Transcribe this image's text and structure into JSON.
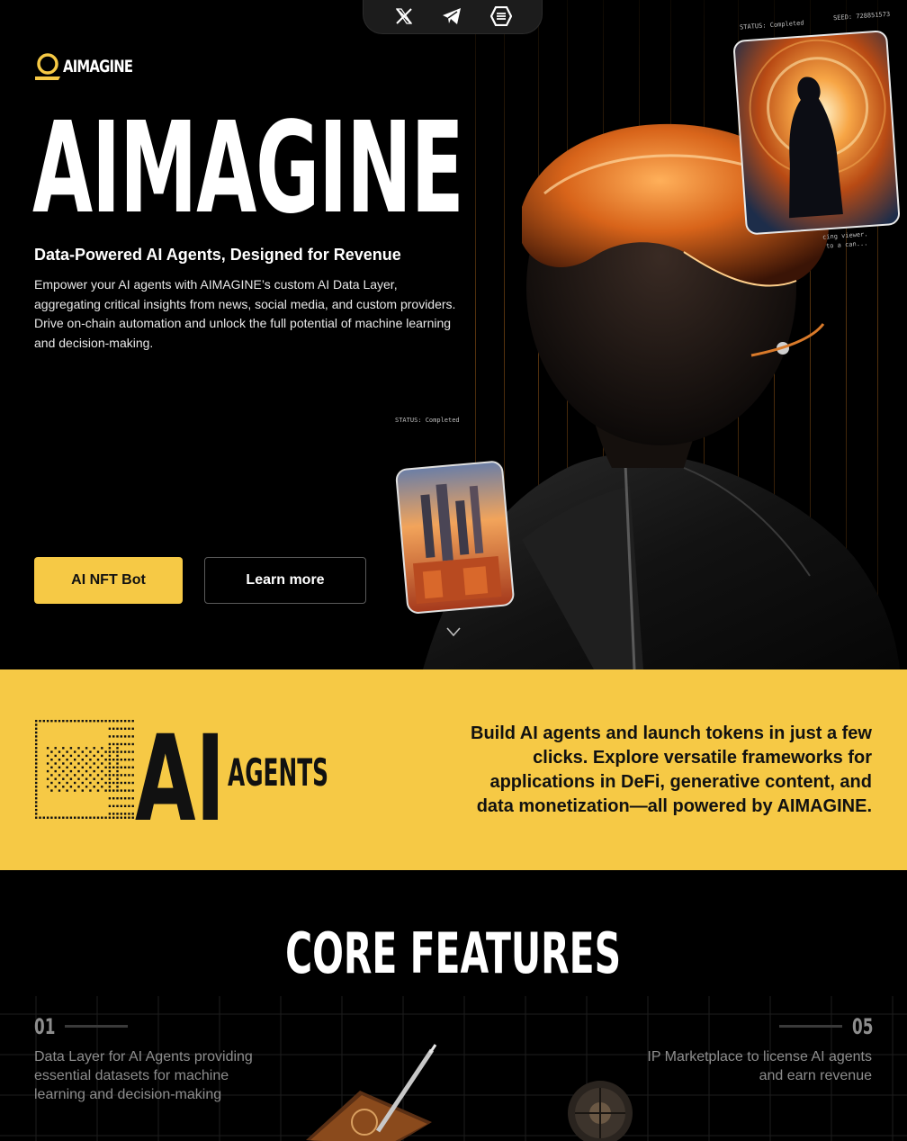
{
  "social": {
    "icons": [
      "x-icon",
      "telegram-icon",
      "token-icon"
    ]
  },
  "logo": {
    "text": "AIMAGINE"
  },
  "hero": {
    "title": "AIMAGINE",
    "subtitle": "Data-Powered AI Agents, Designed for Revenue",
    "description": "Empower your AI agents with AIMAGINE’s custom AI Data Layer, aggregating critical insights from news, social media, and custom providers. Drive on-chain automation and unlock the full potential of machine learning and decision-making.",
    "primary_button": "AI NFT Bot",
    "secondary_button": "Learn more",
    "card_top": {
      "status": "STATUS: Completed",
      "seed": "SEED: 728851573",
      "caption_1": "cing viewer.",
      "caption_2": "to a can..."
    },
    "card_small": {
      "status": "STATUS: Completed"
    }
  },
  "band": {
    "logo_big": "AI",
    "logo_small": "AGENTS",
    "text": "Build AI agents and launch tokens in just a few clicks. Explore versatile frameworks for applications in DeFi, generative content, and data monetization—all powered by AIMAGINE."
  },
  "features": {
    "title": "CORE FEATURES",
    "left": {
      "number": "01",
      "text": "Data Layer for AI Agents providing essential datasets for machine learning and decision-making"
    },
    "right": {
      "number": "05",
      "text": "IP Marketplace to license AI agents and earn revenue"
    }
  },
  "colors": {
    "accent": "#f6c945",
    "background": "#000000",
    "muted_text": "#8d8d8d"
  }
}
